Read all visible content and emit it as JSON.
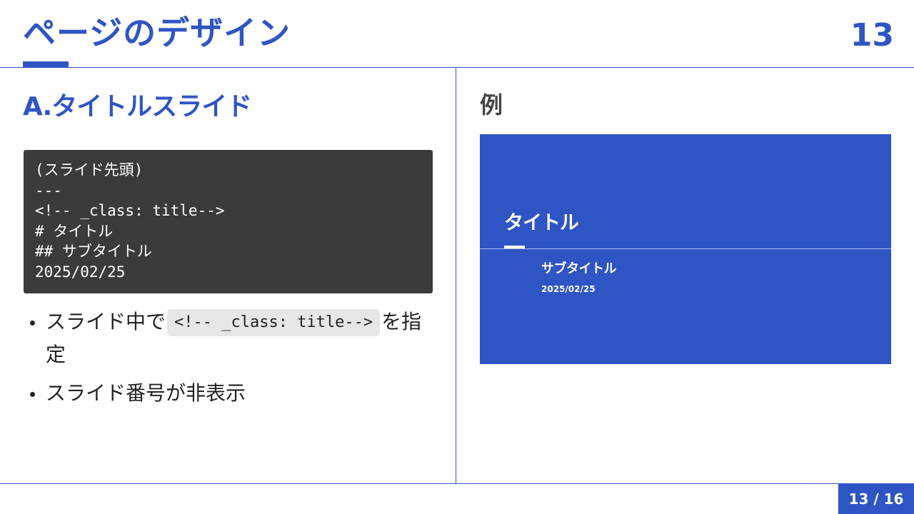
{
  "header": {
    "title": "ページのデザイン",
    "slide_number": "13"
  },
  "left": {
    "section_title": "A.タイトルスライド",
    "code_lines": [
      "(スライド先頭)",
      "---",
      "<!-- _class: title-->",
      "# タイトル",
      "## サブタイトル",
      "2025/02/25"
    ],
    "bullets": [
      {
        "before": "スライド中で",
        "code": "<!-- _class: title-->",
        "after": "を指定"
      },
      {
        "text": "スライド番号が非表示"
      }
    ]
  },
  "right": {
    "label": "例",
    "preview": {
      "title": "タイトル",
      "subtitle": "サブタイトル",
      "date": "2025/02/25"
    }
  },
  "footer": {
    "page_indicator": "13 / 16"
  },
  "colors": {
    "accent": "#2f55c4",
    "code_bg": "#3b3b3b",
    "inline_code_bg": "#e6e6e6"
  }
}
